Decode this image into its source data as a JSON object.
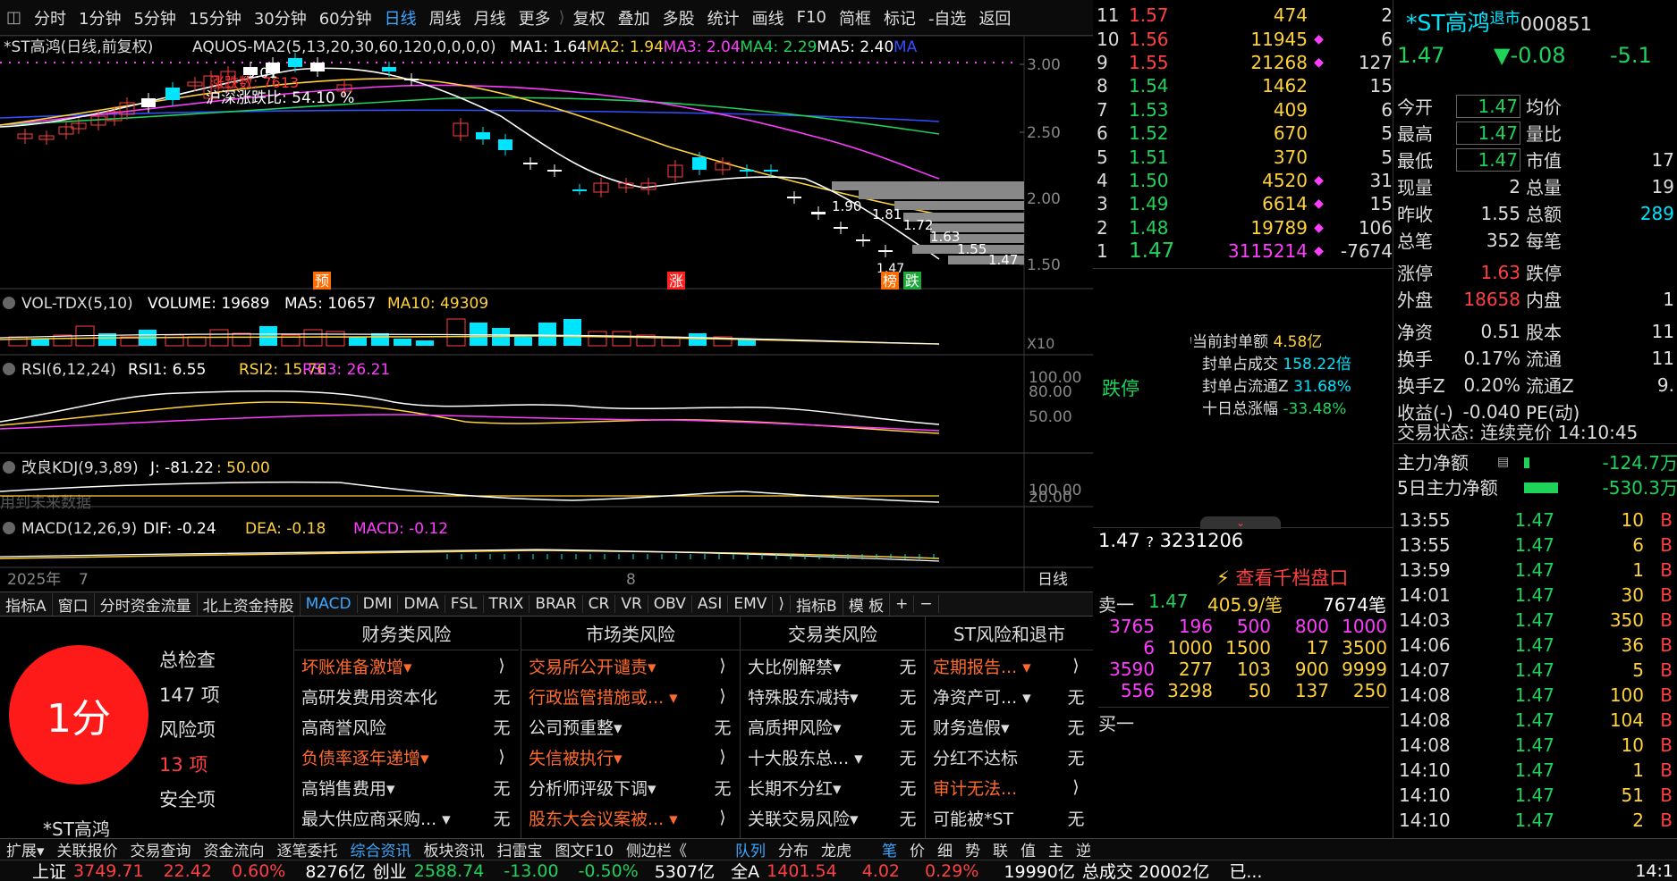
{
  "toolbar": {
    "periods": [
      "分时",
      "1分钟",
      "5分钟",
      "15分钟",
      "30分钟",
      "60分钟",
      "日线",
      "周线",
      "月线",
      "更多"
    ],
    "active_period": "日线",
    "tools": [
      "复权",
      "叠加",
      "多股",
      "统计",
      "画线",
      "F10",
      "简框",
      "标记",
      "-自选",
      "返回"
    ]
  },
  "chart": {
    "title": "*ST高鸿(日线,前复权)",
    "ma_formula": "AQUOS-MA2(5,13,20,30,60,120,0,0,0,0)",
    "ma_values": [
      {
        "label": "MA1: 1.64",
        "color": "#ffffff"
      },
      {
        "label": "MA2: 1.94",
        "color": "#ffd23a"
      },
      {
        "label": "MA3: 2.04",
        "color": "#ff3cff"
      },
      {
        "label": "MA4: 2.29",
        "color": "#1fd25a"
      },
      {
        "label": "MA5: 2.40",
        "color": "#ffffff"
      },
      {
        "label": "MA",
        "color": "#3050ff"
      }
    ],
    "price_axis": [
      "3.00",
      "2.50",
      "2.00",
      "1.50"
    ],
    "annotations": {
      "high": "3.01",
      "overlay1": "涨跌数: 7613",
      "overlay2": "沪深涨跌比: 54.10 %",
      "prices": [
        "1.90",
        "1.81",
        "1.72",
        "1.63",
        "1.55",
        "1.47"
      ],
      "low": "1.47"
    },
    "markers": [
      "预",
      "涨",
      "榜",
      "跌"
    ],
    "volume": {
      "label": "VOL-TDX(5,10)",
      "volume": "VOLUME: 19689",
      "ma5": "MA5: 10657",
      "ma10": "MA10: 49309",
      "scale": "X10"
    },
    "rsi": {
      "label": "RSI(6,12,24)",
      "rsi1": "RSI1: 6.55",
      "rsi2": "RSI2: 15.76",
      "rsi3": "RSI3: 26.21",
      "axis": [
        "100.00",
        "80.00",
        "50.00"
      ]
    },
    "kdj": {
      "label": "改良KDJ(9,3,89)",
      "j": "J: -81.22",
      "val": ": 50.00",
      "note": "用到未来数据",
      "axis": [
        "100.00",
        "20.00"
      ]
    },
    "macd": {
      "label": "MACD(12,26,9)",
      "dif": "DIF: -0.24",
      "dea": "DEA: -0.18",
      "macd": "MACD: -0.12"
    },
    "date_axis": {
      "year": "2025年",
      "m1": "7",
      "m2": "8",
      "period": "日线"
    }
  },
  "order_book": {
    "asks": [
      {
        "lv": "11",
        "price": "1.57",
        "vol": "474",
        "mk": "",
        "ex": "2"
      },
      {
        "lv": "10",
        "price": "1.56",
        "vol": "11945",
        "mk": "◆",
        "ex": "6"
      },
      {
        "lv": "9",
        "price": "1.55",
        "vol": "21268",
        "mk": "◆",
        "ex": "127"
      },
      {
        "lv": "8",
        "price": "1.54",
        "vol": "1462",
        "mk": "",
        "ex": "15"
      },
      {
        "lv": "7",
        "price": "1.53",
        "vol": "409",
        "mk": "",
        "ex": "6"
      },
      {
        "lv": "6",
        "price": "1.52",
        "vol": "670",
        "mk": "",
        "ex": "5"
      },
      {
        "lv": "5",
        "price": "1.51",
        "vol": "370",
        "mk": "",
        "ex": "5"
      },
      {
        "lv": "4",
        "price": "1.50",
        "vol": "4520",
        "mk": "◆",
        "ex": "31"
      },
      {
        "lv": "3",
        "price": "1.49",
        "vol": "6614",
        "mk": "◆",
        "ex": "15"
      },
      {
        "lv": "2",
        "price": "1.48",
        "vol": "19789",
        "mk": "◆",
        "ex": "106"
      },
      {
        "lv": "1",
        "price": "1.47",
        "vol": "3115214",
        "mk": "◆",
        "ex": "-7674"
      }
    ]
  },
  "limit_info": {
    "status": "跌停",
    "seal_amount_label": "当前封单额",
    "seal_amount": "4.58亿",
    "seal_turnover_label": "封单占成交",
    "seal_turnover": "158.22倍",
    "seal_float_label": "封单占流通Z",
    "seal_float": "31.68%",
    "ten_day_label": "十日总涨幅",
    "ten_day": "-33.48%"
  },
  "bid_panel": {
    "price": "1.47",
    "q": "?",
    "qty": "3231206",
    "link": "查看千档盘口",
    "sell1_label": "卖一",
    "sell1_price": "1.47",
    "sell1_avg": "405.9/笔",
    "sell1_count": "7674笔",
    "grid": [
      [
        "3765",
        "196",
        "500",
        "800",
        "1000"
      ],
      [
        "6",
        "1000",
        "1500",
        "17",
        "3500"
      ],
      [
        "3590",
        "277",
        "103",
        "900",
        "9999"
      ],
      [
        "556",
        "3298",
        "50",
        "137",
        "250"
      ]
    ],
    "buy1_label": "买一"
  },
  "stock": {
    "name": "*ST高鸿",
    "tag": "退市",
    "code": "000851",
    "price": "1.47",
    "change": "▼-0.08",
    "pct": "-5.1",
    "rows": [
      {
        "k": "今开",
        "v": "1.47",
        "k2": "均价",
        "v2": ""
      },
      {
        "k": "最高",
        "v": "1.47",
        "k2": "量比",
        "v2": ""
      },
      {
        "k": "最低",
        "v": "1.47",
        "k2": "市值",
        "v2": "17"
      },
      {
        "k": "现量",
        "v": "2",
        "k2": "总量",
        "v2": "19"
      },
      {
        "k": "昨收",
        "v": "1.55",
        "k2": "总额",
        "v2": "289"
      },
      {
        "k": "总笔",
        "v": "352",
        "k2": "每笔",
        "v2": ""
      },
      {
        "k": "涨停",
        "v": "1.63",
        "k2": "跌停",
        "v2": ""
      },
      {
        "k": "外盘",
        "v": "18658",
        "k2": "内盘",
        "v2": "1"
      },
      {
        "k": "净资",
        "v": "0.51",
        "k2": "股本",
        "v2": "11"
      },
      {
        "k": "换手",
        "v": "0.17%",
        "k2": "流通",
        "v2": "11"
      },
      {
        "k": "换手Z",
        "v": "0.20%",
        "k2": "流通Z",
        "v2": "9."
      },
      {
        "k": "收益(-)",
        "v": "-0.040",
        "k2": "PE(动)",
        "v2": ""
      }
    ],
    "trade_status": "交易状态: 连续竞价 14:10:45",
    "main_flow_label": "主力净额",
    "main_flow": "-124.7万",
    "main5_label": "5日主力净额",
    "main5": "-530.3万"
  },
  "ticks": [
    {
      "t": "13:55",
      "p": "1.47",
      "q": "10",
      "b": "B"
    },
    {
      "t": "13:55",
      "p": "1.47",
      "q": "6",
      "b": "B"
    },
    {
      "t": "13:59",
      "p": "1.47",
      "q": "1",
      "b": "B"
    },
    {
      "t": "14:01",
      "p": "1.47",
      "q": "30",
      "b": "B"
    },
    {
      "t": "14:03",
      "p": "1.47",
      "q": "350",
      "b": "B"
    },
    {
      "t": "14:06",
      "p": "1.47",
      "q": "36",
      "b": "B"
    },
    {
      "t": "14:07",
      "p": "1.47",
      "q": "5",
      "b": "B"
    },
    {
      "t": "14:08",
      "p": "1.47",
      "q": "100",
      "b": "B"
    },
    {
      "t": "14:08",
      "p": "1.47",
      "q": "104",
      "b": "B"
    },
    {
      "t": "14:08",
      "p": "1.47",
      "q": "10",
      "b": "B"
    },
    {
      "t": "14:10",
      "p": "1.47",
      "q": "1",
      "b": "B"
    },
    {
      "t": "14:10",
      "p": "1.47",
      "q": "51",
      "b": "B"
    },
    {
      "t": "14:10",
      "p": "1.47",
      "q": "2",
      "b": "B"
    }
  ],
  "indicator_tabs": [
    "指标A",
    "窗口",
    "分时资金流量",
    "北上资金持股",
    "MACD",
    "DMI",
    "DMA",
    "FSL",
    "TRIX",
    "BRAR",
    "CR",
    "VR",
    "OBV",
    "ASI",
    "EMV",
    "⟩",
    "指标B",
    "模 板",
    "+",
    "−"
  ],
  "active_indicator": "MACD",
  "risk": {
    "score": "1分",
    "summary": [
      "总检查",
      "147 项",
      "风险项",
      "13 项",
      "安全项"
    ],
    "stock_label": "*ST高鸿",
    "columns": [
      {
        "title": "财务类风险",
        "items": [
          {
            "n": "坏账准备激增▾",
            "s": "⟩",
            "hl": true
          },
          {
            "n": "高研发费用资本化",
            "s": "无",
            "hl": false
          },
          {
            "n": "高商誉风险",
            "s": "无",
            "hl": false
          },
          {
            "n": "负债率逐年递增▾",
            "s": "⟩",
            "hl": true
          },
          {
            "n": "高销售费用▾",
            "s": "无",
            "hl": false
          },
          {
            "n": "最大供应商采购... ▾",
            "s": "无",
            "hl": false
          }
        ]
      },
      {
        "title": "市场类风险",
        "items": [
          {
            "n": "交易所公开谴责▾",
            "s": "⟩",
            "hl": true
          },
          {
            "n": "行政监管措施或... ▾",
            "s": "⟩",
            "hl": true
          },
          {
            "n": "公司预重整▾",
            "s": "无",
            "hl": false
          },
          {
            "n": "失信被执行▾",
            "s": "⟩",
            "hl": true
          },
          {
            "n": "分析师评级下调▾",
            "s": "无",
            "hl": false
          },
          {
            "n": "股东大会议案被... ▾",
            "s": "⟩",
            "hl": true
          }
        ]
      },
      {
        "title": "交易类风险",
        "items": [
          {
            "n": "大比例解禁▾",
            "s": "无",
            "hl": false
          },
          {
            "n": "特殊股东减持▾",
            "s": "无",
            "hl": false
          },
          {
            "n": "高质押风险▾",
            "s": "无",
            "hl": false
          },
          {
            "n": "十大股东总... ▾",
            "s": "无",
            "hl": false
          },
          {
            "n": "长期不分红▾",
            "s": "无",
            "hl": false
          },
          {
            "n": "关联交易风险▾",
            "s": "无",
            "hl": false
          }
        ]
      },
      {
        "title": "ST风险和退市",
        "items": [
          {
            "n": "定期报告... ▾",
            "s": "⟩",
            "hl": true
          },
          {
            "n": "净资产可... ▾",
            "s": "无",
            "hl": false
          },
          {
            "n": "财务造假▾",
            "s": "无",
            "hl": false
          },
          {
            "n": "分红不达标",
            "s": "无",
            "hl": false
          },
          {
            "n": "审计无法...",
            "s": "⟩",
            "hl": true
          },
          {
            "n": "可能被*ST",
            "s": "无",
            "hl": false
          }
        ]
      }
    ]
  },
  "bottom_tabs": [
    "扩展▾",
    "关联报价",
    "交易查询",
    "资金流向",
    "逐笔委托",
    "综合资讯",
    "板块资讯",
    "扫雷宝",
    "图文F10",
    "侧边栏《",
    "队列",
    "分布",
    "龙虎",
    "笔",
    "价",
    "细",
    "势",
    "联",
    "值",
    "主",
    "逆"
  ],
  "status_bar": {
    "sh_label": "上证",
    "sh_val": "3749.71",
    "sh_chg": "22.42",
    "sh_pct": "0.60%",
    "sh_amt": "8276亿",
    "cy_label": "创业",
    "cy_val": "2588.74",
    "cy_chg": "-13.00",
    "cy_pct": "-0.50%",
    "cy_amt": "5307亿",
    "qa_label": "全A",
    "qa_val": "1401.54",
    "qa_chg": "4.02",
    "qa_pct": "0.29%",
    "qa_amt": "19990亿",
    "total": "总成交 20002亿",
    "trail": "已...",
    "clock": "14:1"
  }
}
